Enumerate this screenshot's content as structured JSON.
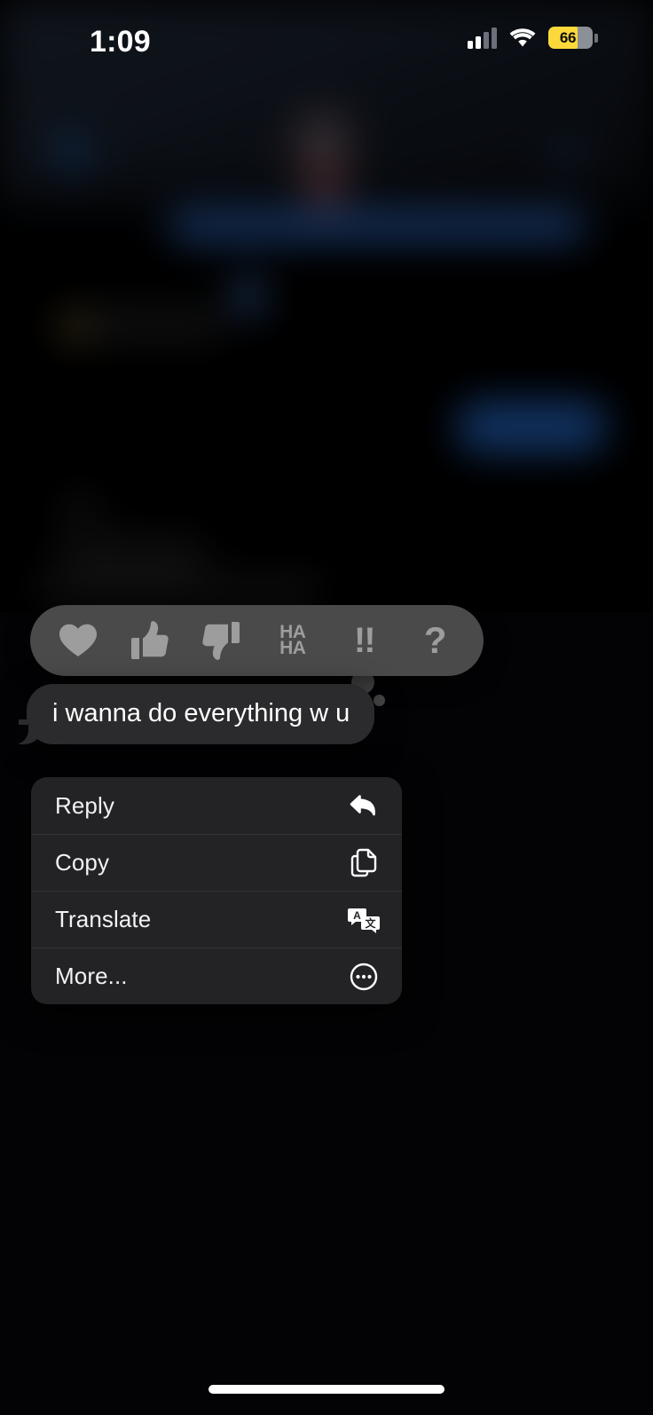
{
  "status_bar": {
    "time": "1:09",
    "cellular_icon": "cellular-bars-icon",
    "cellular_bars_filled": 2,
    "cellular_bars_total": 4,
    "wifi_icon": "wifi-icon",
    "battery_icon": "battery-icon",
    "battery_percent": "66",
    "battery_level": 66,
    "battery_color": "#fcd93a",
    "low_power_mode": true
  },
  "reaction_bar": {
    "name": "tapback-reaction-bar",
    "background_color": "#4a4a4a",
    "items": [
      {
        "id": "heart",
        "label": "Love",
        "icon": "heart-icon"
      },
      {
        "id": "thumbsup",
        "label": "Like",
        "icon": "thumbs-up-icon"
      },
      {
        "id": "thumbsdown",
        "label": "Dislike",
        "icon": "thumbs-down-icon"
      },
      {
        "id": "haha",
        "label": "Haha",
        "icon": "haha-icon",
        "line1": "HA",
        "line2": "HA"
      },
      {
        "id": "exclamation",
        "label": "Emphasize",
        "icon": "double-exclamation-icon",
        "glyph": "!!"
      },
      {
        "id": "question",
        "label": "Question",
        "icon": "question-mark-icon",
        "glyph": "?"
      }
    ]
  },
  "focused_message": {
    "text": "i wanna do everything w u",
    "direction": "incoming",
    "bubble_color": "#2b2b2d",
    "text_color": "#ffffff"
  },
  "context_menu": {
    "background_color": "#232325",
    "items": [
      {
        "label": "Reply",
        "icon": "reply-arrow-icon"
      },
      {
        "label": "Copy",
        "icon": "copy-documents-icon"
      },
      {
        "label": "Translate",
        "icon": "translate-bubbles-icon"
      },
      {
        "label": "More...",
        "icon": "ellipsis-circle-icon"
      }
    ]
  },
  "home_indicator": {
    "name": "home-indicator"
  }
}
